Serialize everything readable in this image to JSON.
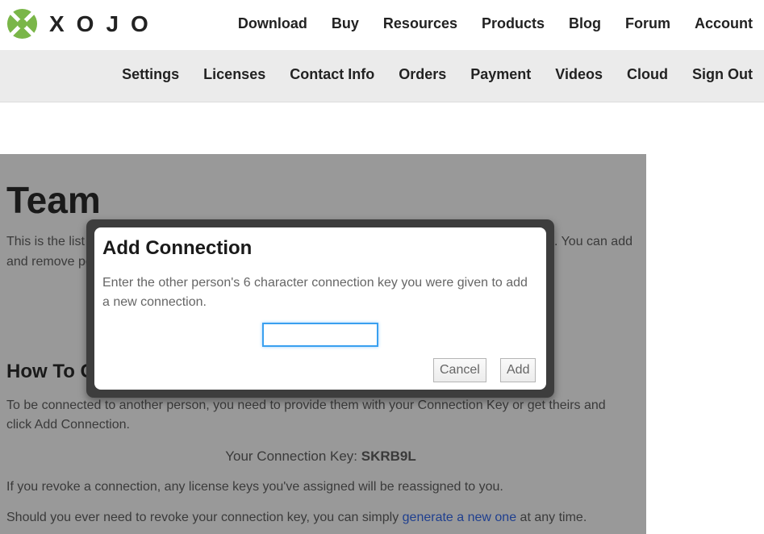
{
  "brand": {
    "name": "XOJO",
    "logo_color": "#7ab648"
  },
  "main_nav": [
    "Download",
    "Buy",
    "Resources",
    "Products",
    "Blog",
    "Forum",
    "Account"
  ],
  "sub_nav": [
    "Settings",
    "Licenses",
    "Contact Info",
    "Orders",
    "Payment",
    "Videos",
    "Cloud",
    "Sign Out"
  ],
  "page": {
    "title": "Team",
    "intro_line1_left": "This is the list o",
    "intro_line1_right": "s. You can add",
    "intro_line2_left": "and remove pe",
    "howto_heading": "How To Ge",
    "howto_line1": "To be connected to another person, you need to provide them with your Connection Key or get theirs and",
    "howto_line2": "click Add Connection.",
    "key_label": "Your Connection Key: ",
    "key_value": "SKRB9L",
    "revoke_text": "If you revoke a connection, any license keys you've assigned will be reassigned to you.",
    "regen_before": "Should you ever need to revoke your connection key, you can simply ",
    "regen_link": "generate a new one",
    "regen_after": " at any time."
  },
  "dialog": {
    "title": "Add Connection",
    "message": "Enter the other person's 6 character connection key you were given to add a new connection.",
    "input_value": "",
    "cancel_label": "Cancel",
    "add_label": "Add"
  }
}
